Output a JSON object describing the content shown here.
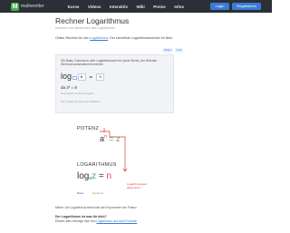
{
  "header": {
    "logo_mark": "M",
    "logo_text": "matheretter",
    "nav": [
      "Kurse",
      "Videos",
      "Interaktiv",
      "Wiki",
      "Preise",
      "Infos"
    ],
    "login": "Login",
    "register": "Registrieren",
    "colors": {
      "bar": "#2c2f36",
      "accent": "#3a7bd5",
      "logo": "#4caf50"
    }
  },
  "page": {
    "title": "Rechner Logarithmus",
    "subtitle": "Rechner zum Berechnen des Logarithmus",
    "intro_prefix": "Online-Rechner für den ",
    "intro_link": "Logarithmus",
    "intro_suffix": ". Der schnellste Logarithmusrechner im Netz."
  },
  "share": [
    "Teilen",
    "Link"
  ],
  "calculator": {
    "instructions": "Gib Basis, Nummerus oder Logarithmuswert ein (zwei Werte), der fehlende Wert wird automatisch berechnet.",
    "log_word": "log",
    "base_value": "",
    "argument_value": "8",
    "result_value": "3",
    "formula": "da 2³ = 8",
    "note": "Dezimalzahl mit Punkt eingeben.",
    "hint": "Tipp: Ändere die Werte per Pfeiltasten."
  },
  "diagram": {
    "top_label": "POTENZ",
    "power_base": "a",
    "power_exp": "n",
    "power_rest": " = z",
    "bottom_label": "LOGARITHMUS",
    "log_word": "log",
    "log_base": "a",
    "log_arg": "z",
    "log_equals": " = ",
    "log_result": "n",
    "basis_label": "Basis",
    "numerus_label": "Numerus",
    "logwert_label": "Logarithmuswert (Exponent)",
    "colors": {
      "exponent": "#e33a3a",
      "numerus": "#4caf50",
      "base": "#4254d4"
    }
  },
  "caption": "Merke: Der Logarithmus berechnet den Exponenten der Potenz.",
  "faq": {
    "question": "Der Logarithmus ist was für dich?",
    "answer_prefix": "Erfahre alles Wichtige über den ",
    "answer_link": "Logarithmus und seine Formeln"
  }
}
